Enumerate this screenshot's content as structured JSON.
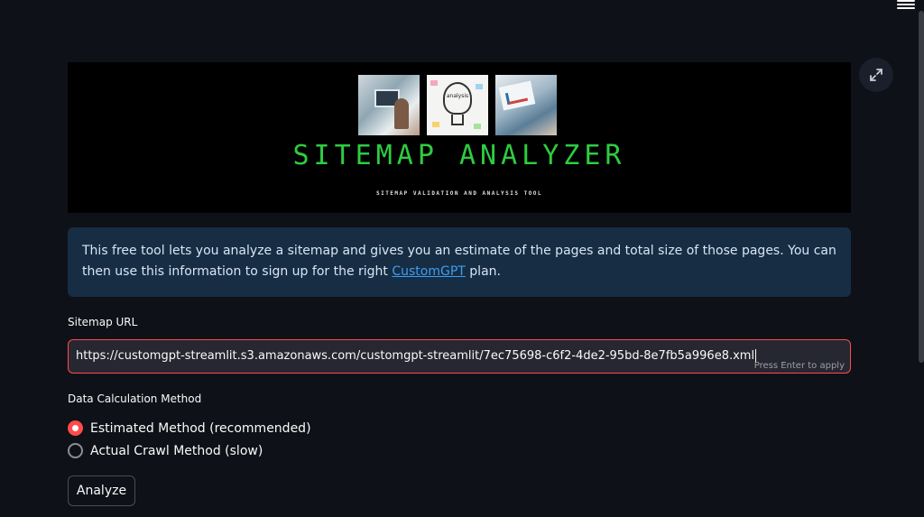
{
  "header": {
    "menu_icon": "hamburger-menu-icon"
  },
  "banner": {
    "title": "SITEMAP ANALYZER",
    "subtitle": "SITEMAP VALIDATION AND ANALYSIS TOOL",
    "bulb_text": "analysis",
    "title_color": "#2ecc40",
    "fullscreen_icon": "expand-icon"
  },
  "info": {
    "text_before": "This free tool lets you analyze a sitemap and gives you an estimate of the pages and total size of those pages. You can then use this information to sign up for the right ",
    "link_text": "CustomGPT",
    "text_after": " plan.",
    "background_color": "#172d43",
    "link_color": "#3d9df3"
  },
  "sitemap_input": {
    "label": "Sitemap URL",
    "value": "https://customgpt-streamlit.s3.amazonaws.com/customgpt-streamlit/7ec75698-c6f2-4de2-95bd-8e7fb5a996e8.xml",
    "hint": "Press Enter to apply",
    "border_color": "#ff4b4b"
  },
  "method": {
    "label": "Data Calculation Method",
    "options": [
      {
        "label": "Estimated Method (recommended)",
        "selected": true
      },
      {
        "label": "Actual Crawl Method (slow)",
        "selected": false
      }
    ],
    "accent_color": "#ff4b4b"
  },
  "actions": {
    "analyze_label": "Analyze"
  }
}
